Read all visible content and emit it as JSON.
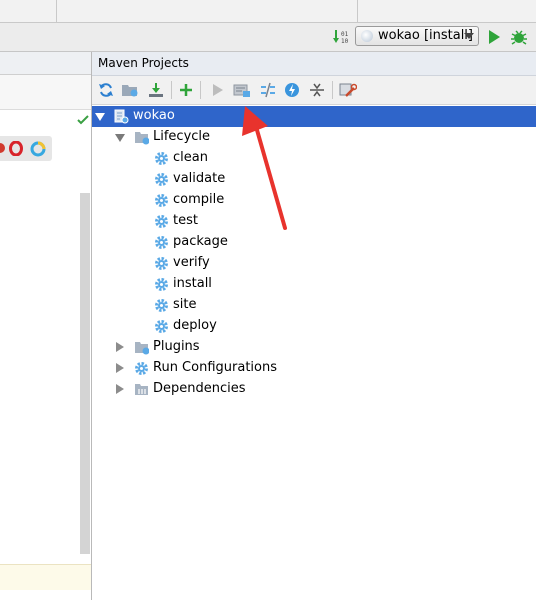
{
  "run_toolbar": {
    "config_label": "wokao [install]"
  },
  "maven": {
    "title": "Maven Projects",
    "toolbar": [
      {
        "icon": "reimport-icon"
      },
      {
        "icon": "generate-sources-icon"
      },
      {
        "icon": "download-icon"
      },
      {
        "icon": "add-icon"
      },
      {
        "icon": "run-icon"
      },
      {
        "icon": "execute-goal-icon"
      },
      {
        "icon": "toggle-offline-icon"
      },
      {
        "icon": "skip-tests-icon"
      },
      {
        "icon": "collapse-all-icon"
      },
      {
        "icon": "settings-icon"
      }
    ],
    "project": "wokao",
    "lifecycle_label": "Lifecycle",
    "lifecycle": [
      "clean",
      "validate",
      "compile",
      "test",
      "package",
      "verify",
      "install",
      "site",
      "deploy"
    ],
    "plugins_label": "Plugins",
    "run_configurations_label": "Run Configurations",
    "dependencies_label": "Dependencies"
  },
  "colors": {
    "selection": "#2f65ca",
    "annotation_arrow": "#e8332d",
    "run_green": "#2fa43a",
    "gear_blue": "#5aa9e6"
  }
}
